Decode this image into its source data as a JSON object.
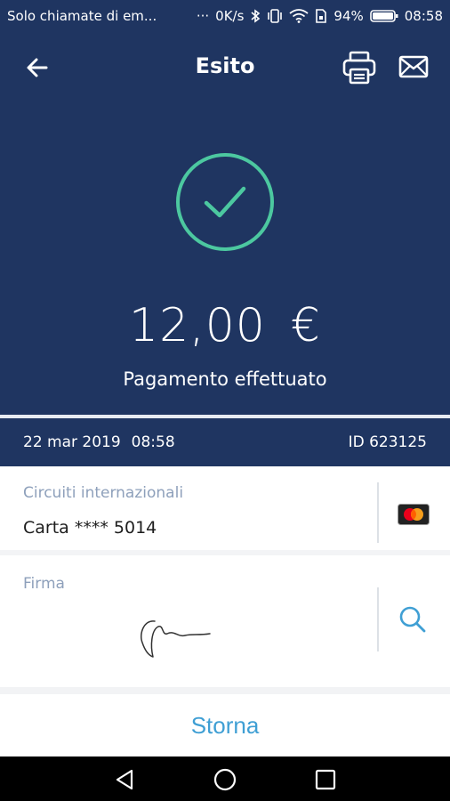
{
  "status_bar": {
    "notification_text": "Solo chiamate di em...",
    "more_dots": "···",
    "network_speed": "0K/s",
    "battery_percent": "94%",
    "time": "08:58"
  },
  "app_bar": {
    "title": "Esito",
    "icons": [
      "back-arrow-icon",
      "printer-icon",
      "mail-icon"
    ]
  },
  "result": {
    "status_icon": "check-circle-icon",
    "amount": "12,00",
    "currency": "€",
    "message": "Pagamento effettuato"
  },
  "transaction": {
    "date": "22 mar 2019",
    "time": "08:58",
    "id": "ID 623125"
  },
  "card": {
    "label": "Circuiti internazionali",
    "value": "Carta **** 5014",
    "brand_icon": "mastercard-icon"
  },
  "signature": {
    "label": "Firma",
    "zoom_icon": "magnifier-icon"
  },
  "actions": {
    "refund_label": "Storna"
  },
  "colors": {
    "primary_navy": "#1f3561",
    "accent_green": "#4cc8a0",
    "action_blue": "#3f9fd4",
    "label_gray": "#8ea0bb"
  }
}
